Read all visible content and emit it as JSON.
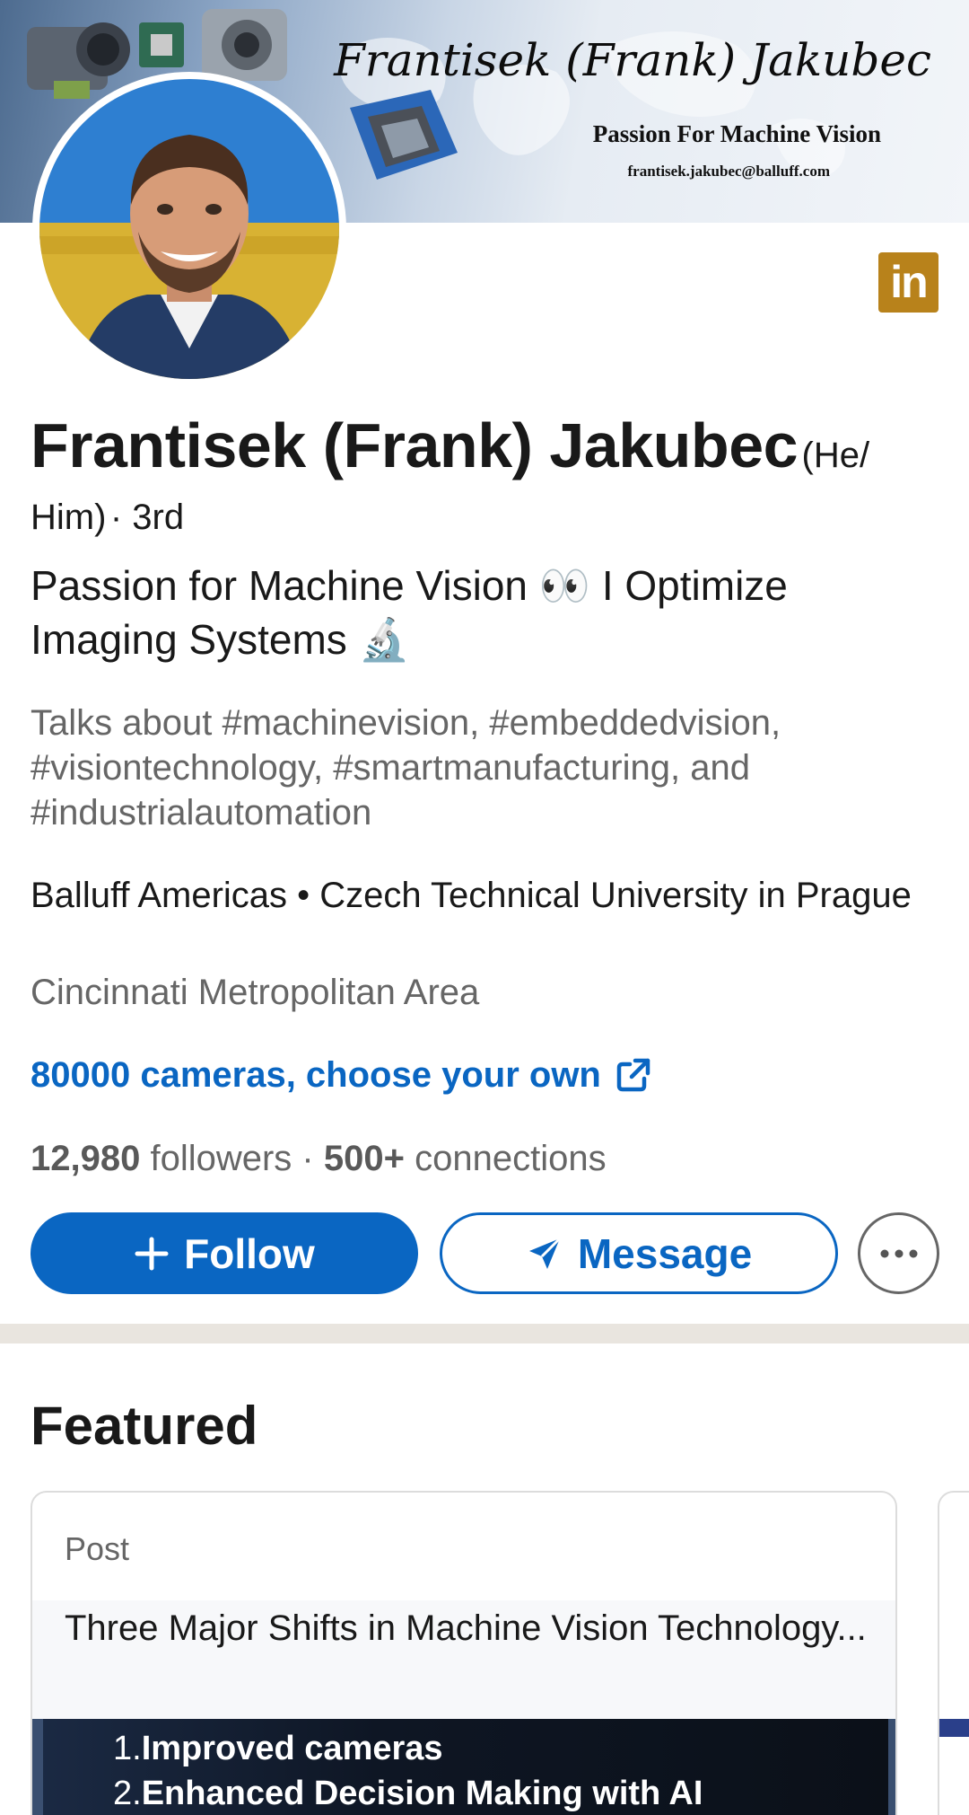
{
  "banner": {
    "name": "Frantisek (Frank) Jakubec",
    "tagline": "Passion For Machine Vision",
    "email": "frantisek.jakubec@balluff.com"
  },
  "profile": {
    "name": "Frantisek (Frank) Jakubec",
    "pronouns": "(He/ Him)",
    "degree": "· 3rd",
    "headline": "Passion for Machine Vision 👀 I Optimize Imaging Systems 🔬",
    "talks_about": "Talks about #machinevision, #embeddedvision, #visiontechnology, #smartmanufacturing, and #industrialautomation",
    "education": "Balluff Americas • Czech Technical University in Prague",
    "location": "Cincinnati Metropolitan Area",
    "website_link": "80000 cameras, choose your own",
    "followers_count": "12,980",
    "followers_label": "followers ·",
    "connections_count": "500+",
    "connections_label": "connections"
  },
  "badge": {
    "label": "in"
  },
  "actions": {
    "follow_label": "Follow",
    "message_label": "Message"
  },
  "featured": {
    "title": "Featured",
    "card": {
      "type": "Post",
      "text": "Three Major Shifts in Machine Vision Technology...",
      "image_items": [
        {
          "num": "1.",
          "text": "Improved cameras"
        },
        {
          "num": "2.",
          "text": "Enhanced Decision Making with AI"
        }
      ]
    }
  },
  "colors": {
    "primary": "#0a66c2",
    "badge": "#b8821b",
    "divider": "#e9e5df"
  }
}
